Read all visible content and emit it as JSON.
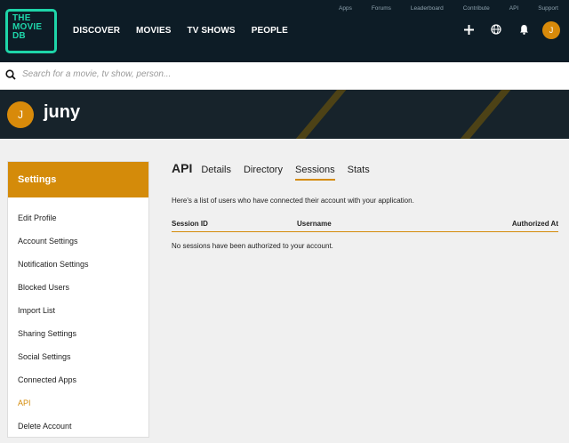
{
  "logo": {
    "line1": "THE",
    "line2": "MOVIE",
    "line3": "DB"
  },
  "nav": [
    "DISCOVER",
    "MOVIES",
    "TV SHOWS",
    "PEOPLE"
  ],
  "top_links": [
    "Apps",
    "Forums",
    "Leaderboard",
    "Contribute",
    "API",
    "Support"
  ],
  "header_icons": {
    "add": "plus-icon",
    "language": "globe-icon",
    "notifications": "bell-icon"
  },
  "user": {
    "initial": "J",
    "name": "juny"
  },
  "search": {
    "placeholder": "Search for a movie, tv show, person..."
  },
  "sidebar": {
    "title": "Settings",
    "items": [
      "Edit Profile",
      "Account Settings",
      "Notification Settings",
      "Blocked Users",
      "Import List",
      "Sharing Settings",
      "Social Settings",
      "Connected Apps",
      "API",
      "Delete Account"
    ],
    "active": "API"
  },
  "content": {
    "section": "API",
    "tabs": [
      "Details",
      "Directory",
      "Sessions",
      "Stats"
    ],
    "selected_tab": "Sessions",
    "intro": "Here's a list of users who have connected their account with your application.",
    "columns": [
      "Session ID",
      "Username",
      "Authorized At"
    ],
    "empty_message": "No sessions have been authorized to your account."
  },
  "colors": {
    "nav_bg": "#0d1c26",
    "accent": "#d48b0a",
    "logo": "#1ed5a9"
  }
}
